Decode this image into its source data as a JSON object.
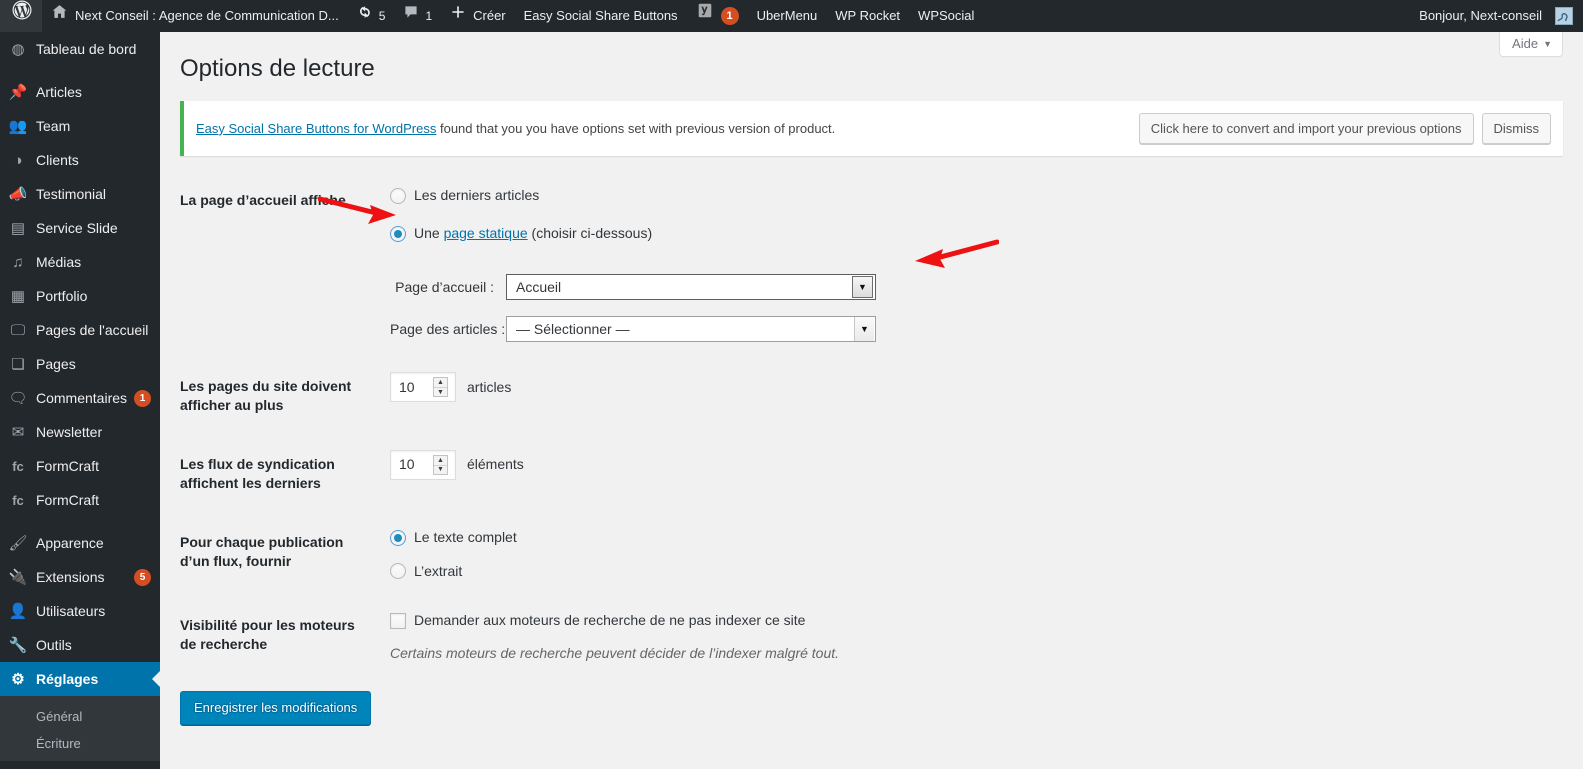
{
  "adminbar": {
    "logo_icon": "wordpress-logo-icon",
    "site_home_icon": "home-icon",
    "site_name": "Next Conseil : Agence de Communication D...",
    "updates_icon": "updates-icon",
    "updates_count": "5",
    "comments_icon": "comment-bubble-icon",
    "comments_count": "1",
    "new_icon": "plus-icon",
    "new_label": "Créer",
    "items": [
      {
        "label": "Easy Social Share Buttons",
        "name": "adminbar-item-easy-social-share-buttons"
      },
      {
        "label": "UberMenu",
        "name": "adminbar-item-ubermenu"
      },
      {
        "label": "WP Rocket",
        "name": "adminbar-item-wp-rocket"
      },
      {
        "label": "WPSocial",
        "name": "adminbar-item-wpsocial"
      }
    ],
    "yoast_icon": "yoast-seo-icon",
    "yoast_badge": "1",
    "howdy": "Bonjour, Next-conseil",
    "avatar_icon": "user-avatar"
  },
  "sidebar": {
    "items": [
      {
        "label": "Tableau de bord",
        "icon": "dashboard-icon",
        "glyph": "◍",
        "name": "sidebar-item-tableau-de-bord",
        "badge": ""
      },
      {
        "sep": true
      },
      {
        "label": "Articles",
        "icon": "pin-icon",
        "glyph": "📌",
        "name": "sidebar-item-articles",
        "badge": ""
      },
      {
        "label": "Team",
        "icon": "group-icon",
        "glyph": "👥",
        "name": "sidebar-item-team",
        "badge": ""
      },
      {
        "label": "Clients",
        "icon": "clients-icon",
        "glyph": "◑",
        "name": "sidebar-item-clients",
        "badge": ""
      },
      {
        "label": "Testimonial",
        "icon": "megaphone-icon",
        "glyph": "📣",
        "name": "sidebar-item-testimonial",
        "badge": ""
      },
      {
        "label": "Service Slide",
        "icon": "image-icon",
        "glyph": "▤",
        "name": "sidebar-item-service-slide",
        "badge": ""
      },
      {
        "label": "Médias",
        "icon": "media-icon",
        "glyph": "♫",
        "name": "sidebar-item-medias",
        "badge": ""
      },
      {
        "label": "Portfolio",
        "icon": "portfolio-image-icon",
        "glyph": "▦",
        "name": "sidebar-item-portfolio",
        "badge": ""
      },
      {
        "label": "Pages de l'accueil",
        "icon": "monitor-icon",
        "glyph": "🖵",
        "name": "sidebar-item-pages-de-laccueil",
        "badge": ""
      },
      {
        "label": "Pages",
        "icon": "page-icon",
        "glyph": "❏",
        "name": "sidebar-item-pages",
        "badge": ""
      },
      {
        "label": "Commentaires",
        "icon": "comment-bubble-icon",
        "glyph": "🗨",
        "name": "sidebar-item-commentaires",
        "badge": "1"
      },
      {
        "label": "Newsletter",
        "icon": "envelope-icon",
        "glyph": "✉",
        "name": "sidebar-item-newsletter",
        "badge": ""
      },
      {
        "label": "FormCraft",
        "icon": "formcraft-icon",
        "glyph": "fc",
        "name": "sidebar-item-formcraft-1",
        "badge": ""
      },
      {
        "label": "FormCraft",
        "icon": "formcraft-icon",
        "glyph": "fc",
        "name": "sidebar-item-formcraft-2",
        "badge": ""
      },
      {
        "sep": true
      },
      {
        "label": "Apparence",
        "icon": "paintbrush-icon",
        "glyph": "🖌",
        "name": "sidebar-item-apparence",
        "badge": ""
      },
      {
        "label": "Extensions",
        "icon": "plug-icon",
        "glyph": "🔌",
        "name": "sidebar-item-extensions",
        "badge": "5"
      },
      {
        "label": "Utilisateurs",
        "icon": "user-icon",
        "glyph": "👤",
        "name": "sidebar-item-utilisateurs",
        "badge": ""
      },
      {
        "label": "Outils",
        "icon": "wrench-icon",
        "glyph": "🔧",
        "name": "sidebar-item-outils",
        "badge": ""
      },
      {
        "label": "Réglages",
        "icon": "settings-sliders-icon",
        "glyph": "⚙",
        "name": "sidebar-item-reglages",
        "badge": "",
        "current": true
      }
    ],
    "submenu": [
      {
        "label": "Général",
        "name": "submenu-item-general"
      },
      {
        "label": "Écriture",
        "name": "submenu-item-ecriture"
      }
    ]
  },
  "page": {
    "help_label": "Aide",
    "help_caret": "▼",
    "title": "Options de lecture"
  },
  "notice": {
    "link_text": "Easy Social Share Buttons for WordPress",
    "body_text": " found that you you have options set with previous version of product.",
    "convert_button": "Click here to convert and import your previous options",
    "dismiss_button": "Dismiss",
    "accent_color": "#46b450"
  },
  "form": {
    "rows": [
      {
        "label": "La page d’accueil affiche",
        "name": "row-front-page-displays"
      },
      {
        "label": "Les pages du site doivent afficher au plus",
        "name": "row-posts-per-page"
      },
      {
        "label": "Les flux de syndication affichent les derniers",
        "name": "row-posts-per-rss"
      },
      {
        "label": "Pour chaque publication d’un flux, fournir",
        "name": "row-rss-use-excerpt"
      },
      {
        "label": "Visibilité pour les moteurs de recherche",
        "name": "row-search-engine-visibility"
      }
    ],
    "front_page": {
      "radio_posts_label": "Les derniers articles",
      "radio_posts_checked": false,
      "radio_static_prefix": "Une ",
      "radio_static_link": "page statique",
      "radio_static_suffix": " (choisir ci-dessous)",
      "radio_static_checked": true,
      "select_home_label": "Page d’accueil :",
      "select_home_value": "Accueil",
      "select_posts_label": "Page des articles :",
      "select_posts_value": "— Sélectionner —"
    },
    "posts_per_page": {
      "value": "10",
      "unit": "articles"
    },
    "posts_per_rss": {
      "value": "10",
      "unit": "éléments"
    },
    "rss_use_excerpt": {
      "full_label": "Le texte complet",
      "full_checked": true,
      "excerpt_label": "L’extrait",
      "excerpt_checked": false
    },
    "search_visibility": {
      "checkbox_label": "Demander aux moteurs de recherche de ne pas indexer ce site",
      "checked": false,
      "description": "Certains moteurs de recherche peuvent décider de l’indexer malgré tout."
    },
    "submit_label": "Enregistrer les modifications"
  },
  "annotations": {
    "arrow_color": "#ee1111",
    "arrow_static_radio": "red-arrow-pointing-to-static-page-radio",
    "arrow_home_select": "red-arrow-pointing-to-homepage-dropdown"
  }
}
